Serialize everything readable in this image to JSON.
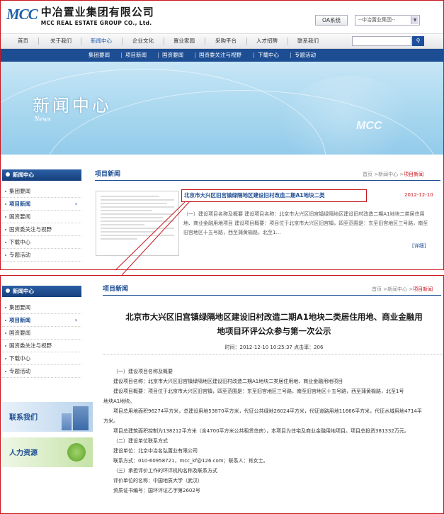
{
  "header": {
    "logo_mark": "MCC",
    "company_cn": "中冶置业集团有限公司",
    "company_en": "MCC REAL ESTATE GROUP CO., Ltd.",
    "oa_label": "OA系统",
    "group_select": "--中冶置业集团--"
  },
  "nav": {
    "items": [
      "首页",
      "关于我们",
      "新闻中心",
      "企业文化",
      "置业家园",
      "采购平台",
      "人才招聘",
      "联系我们"
    ],
    "active": "新闻中心"
  },
  "subnav": {
    "items": [
      "集团要闻",
      "项目新闻",
      "国资要闻",
      "国资委关注与视野",
      "下载中心",
      "专题活动"
    ]
  },
  "banner": {
    "title": "新闻中心",
    "subtitle": "News",
    "watermark": "MCC"
  },
  "sidebar": {
    "header": "新闻中心",
    "items": [
      "集团要闻",
      "项目新闻",
      "国资要闻",
      "国资委关注与视野",
      "下载中心",
      "专题活动"
    ],
    "active": "项目新闻"
  },
  "section": {
    "title": "项目新闻",
    "crumb": [
      "首页",
      "新闻中心",
      "项目新闻"
    ]
  },
  "news": {
    "title": "北京市大兴区旧宫镇绿隔地区建设旧村改造二期A1地块二类",
    "date": "2012-12-10",
    "summary": "（一）建设项目名称及概要  建设项目名称：北京市大兴区旧宫镇绿隔地区建设旧村改造二期A1地块二类居住用地、商业金融用地项目  建设项目概要：项目位于北京市大兴区旧宫镇，四至范围是：东至旧宫地区三号路，南至旧宫地区十五号路，西至蒲黄榆路，北至1…",
    "more": "[详细]"
  },
  "article": {
    "title_line1": "北京市大兴区旧宫镇绿隔地区建设旧村改造二期A1地块二类居住用地、商业金融用",
    "title_line2": "地项目环评公众参与第一次公示",
    "meta": "时间：2012-12-10 10:25:37     点击率：206",
    "paragraphs": [
      "（一）建设项目名称及概要",
      "建设项目名称：北京市大兴区旧宫镇绿隔地区建设旧村改造二期A1地块二类居住用地、商业金融用地项目",
      "建设项目概要：项目位于北京市大兴区旧宫镇，四至范围是：东至旧宫地区三号路，南至旧宫地区十五号路，西至蒲黄榆路，北至1号",
      "地块A1地块。",
      "项目总用地面积96274平方米，总建设用地53870平方米，代征公共绿地26024平方米，代征道路用地11666平方米，代征水域用地4714平",
      "方米。",
      "项目总建筑面积控制为138212平方米（含4700平方米公共租赁住房），本项目为住宅及商业金融用地项目。项目总投资381332万元。",
      "（二）建设单位联系方式",
      "建设单位：北京中冶名弘置业有限公司",
      "联系方式：010-60958721，mcc_kf@126.com；联系人：肖女士。",
      "（三）承担评价工作的环评机构名称及联系方式",
      "评价单位的名称：中国地质大学（武汉）",
      "资质证书编号：国环评证乙字第2602号"
    ]
  },
  "promos": [
    "联系我们",
    "人力资源"
  ],
  "colors": {
    "brand_blue": "#1d4e94",
    "accent_red": "#c8161d"
  }
}
